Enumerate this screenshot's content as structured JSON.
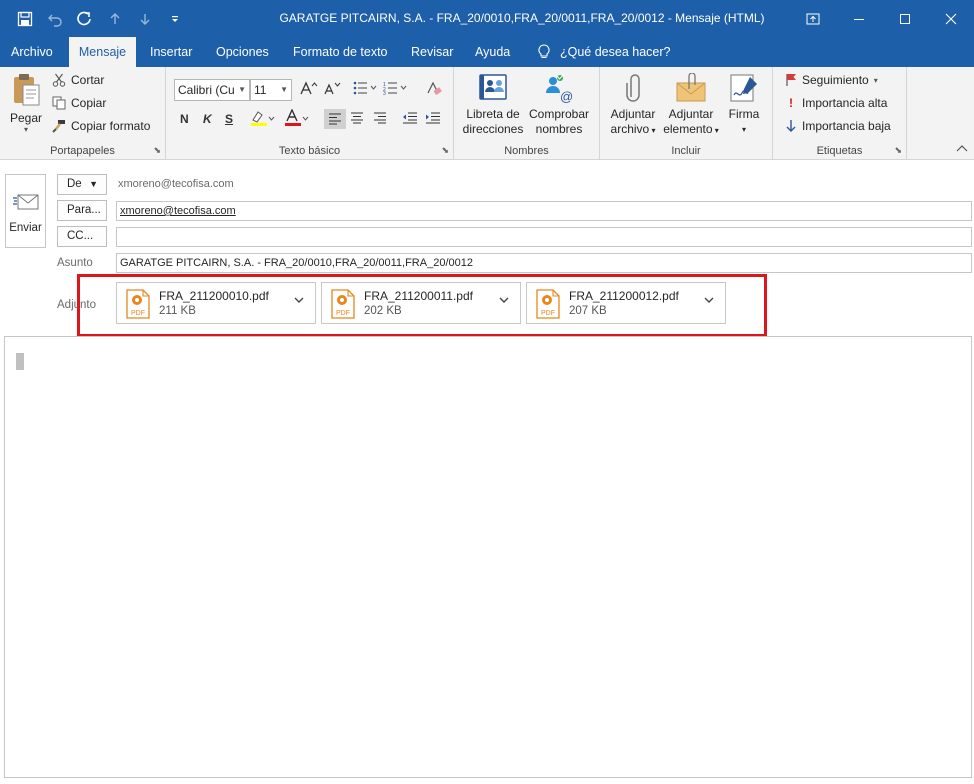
{
  "window": {
    "title": "GARATGE PITCAIRN, S.A. - FRA_20/0010,FRA_20/0011,FRA_20/0012  -  Mensaje (HTML)"
  },
  "tabs": [
    "Archivo",
    "Mensaje",
    "Insertar",
    "Opciones",
    "Formato de texto",
    "Revisar",
    "Ayuda"
  ],
  "active_tab": "Mensaje",
  "tell_me": "¿Qué desea hacer?",
  "ribbon": {
    "portapapeles": {
      "paste": "Pegar",
      "cut": "Cortar",
      "copy": "Copiar",
      "format_painter": "Copiar formato",
      "label": "Portapapeles"
    },
    "texto_basico": {
      "font": "Calibri (Cu",
      "size": "11",
      "bold": "N",
      "italic": "K",
      "underline": "S",
      "label": "Texto básico"
    },
    "nombres": {
      "address_book": [
        "Libreta de",
        "direcciones"
      ],
      "check_names": [
        "Comprobar",
        "nombres"
      ],
      "label": "Nombres"
    },
    "incluir": {
      "attach_file": [
        "Adjuntar",
        "archivo"
      ],
      "attach_item": [
        "Adjuntar",
        "elemento"
      ],
      "signature": "Firma",
      "label": "Incluir"
    },
    "etiquetas": {
      "follow_up": "Seguimiento",
      "high_importance": "Importancia alta",
      "low_importance": "Importancia baja",
      "label": "Etiquetas"
    }
  },
  "compose": {
    "send": "Enviar",
    "from_button": "De",
    "from_value": "xmoreno@tecofisa.com",
    "to_button": "Para...",
    "to_value": "xmoreno@tecofisa.com",
    "cc_button": "CC...",
    "cc_value": "",
    "subject_label": "Asunto",
    "subject_value": "GARATGE PITCAIRN, S.A. - FRA_20/0010,FRA_20/0011,FRA_20/0012",
    "attachments_label": "Adjunto",
    "attachments": [
      {
        "name": "FRA_211200010.pdf",
        "size": "211 KB"
      },
      {
        "name": "FRA_211200011.pdf",
        "size": "202 KB"
      },
      {
        "name": "FRA_211200012.pdf",
        "size": "207 KB"
      }
    ],
    "pdf_badge": "PDF"
  },
  "colors": {
    "accent": "#1e5fa9",
    "highlight_box": "#e0141b",
    "pdf_icon": "#e8861f"
  }
}
